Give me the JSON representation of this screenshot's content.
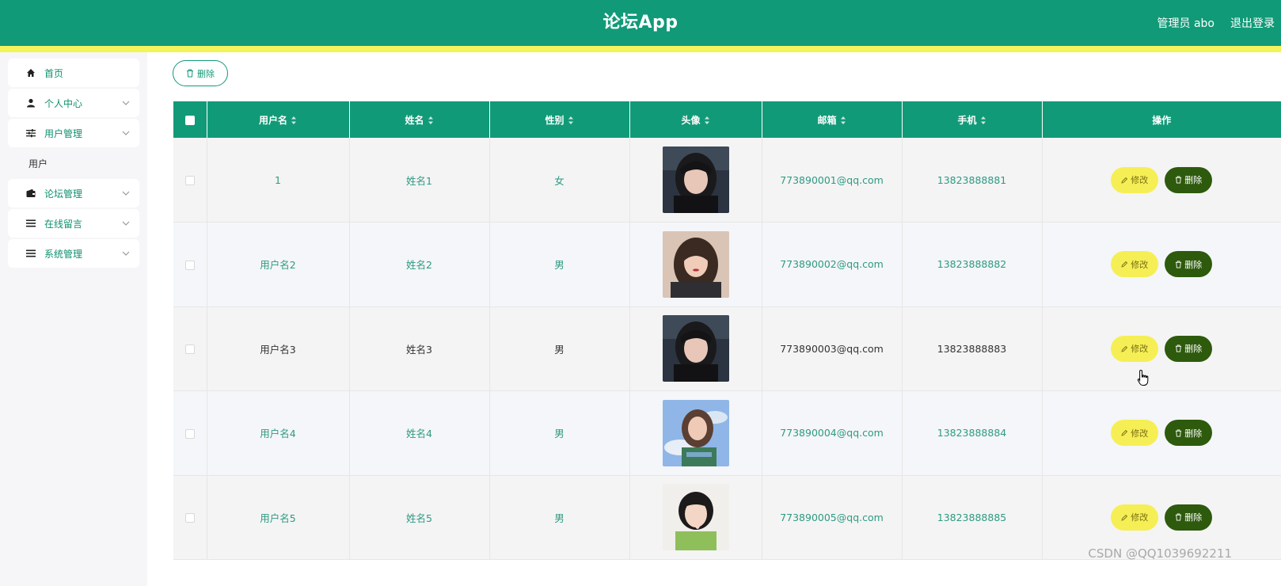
{
  "header": {
    "title": "论坛App",
    "user_label": "管理员 abo",
    "logout_label": "退出登录",
    "bg_color": "#119a78",
    "stripe_color": "#f3f35b"
  },
  "sidebar": {
    "items": [
      {
        "label": "首页",
        "icon": "home-icon"
      },
      {
        "label": "个人中心",
        "icon": "user-icon",
        "expandable": true
      },
      {
        "label": "用户管理",
        "icon": "sliders-icon",
        "expandable": true,
        "submenu": [
          "用户"
        ]
      },
      {
        "label": "论坛管理",
        "icon": "wallet-icon",
        "expandable": true
      },
      {
        "label": "在线留言",
        "icon": "list-icon",
        "expandable": true
      },
      {
        "label": "系统管理",
        "icon": "list-icon",
        "expandable": true
      }
    ]
  },
  "toolbar": {
    "delete_label": "删除"
  },
  "table": {
    "columns": [
      "用户名",
      "姓名",
      "性别",
      "头像",
      "邮箱",
      "手机",
      "操作"
    ],
    "rows": [
      {
        "username": "1",
        "name": "姓名1",
        "gender": "女",
        "email": "773890001@qq.com",
        "phone": "13823888881"
      },
      {
        "username": "用户名2",
        "name": "姓名2",
        "gender": "男",
        "email": "773890002@qq.com",
        "phone": "13823888882"
      },
      {
        "username": "用户名3",
        "name": "姓名3",
        "gender": "男",
        "email": "773890003@qq.com",
        "phone": "13823888883"
      },
      {
        "username": "用户名4",
        "name": "姓名4",
        "gender": "男",
        "email": "773890004@qq.com",
        "phone": "13823888884"
      },
      {
        "username": "用户名5",
        "name": "姓名5",
        "gender": "男",
        "email": "773890005@qq.com",
        "phone": "13823888885"
      }
    ],
    "edit_label": "修改",
    "delete_label": "删除"
  },
  "watermark": "CSDN @QQ1039692211"
}
